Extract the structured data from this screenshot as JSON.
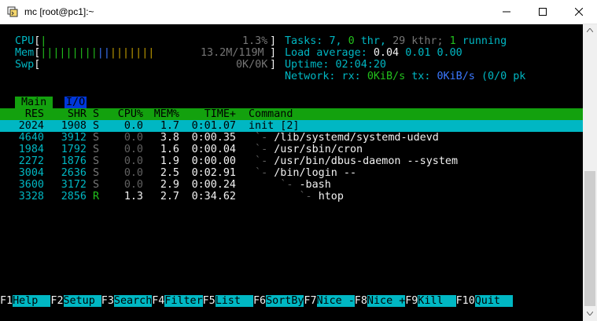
{
  "window": {
    "title": "mc [root@pc1]:~"
  },
  "meters": {
    "cpu": {
      "label": "CPU",
      "bar": "|",
      "value": "1.3%"
    },
    "mem": {
      "label": "Mem",
      "bar": "||||||||||||||||||",
      "value": "13.2M/119M"
    },
    "swp": {
      "label": "Swp",
      "value": "0K/0K"
    }
  },
  "summary": {
    "tasks_label": "Tasks:",
    "tasks": "7,",
    "thr": "0",
    "thr_label": "thr,",
    "kthr": "29",
    "kthr_label": "kthr;",
    "running": "1",
    "running_label": "running",
    "load_label": "Load average:",
    "load1": "0.04",
    "load5": "0.01",
    "load15": "0.00",
    "uptime_label": "Uptime:",
    "uptime": "02:04:20",
    "network_label": "Network: rx:",
    "rx": "0KiB/s",
    "tx_label": "tx:",
    "tx": "0KiB/s",
    "pkts": "(0/0 pk"
  },
  "tabs": {
    "main": "Main",
    "io": "I/O"
  },
  "columns": [
    "RES",
    "SHR",
    "S",
    "CPU%",
    "MEM%",
    "TIME+",
    "Command"
  ],
  "processes": [
    {
      "res": "2024",
      "shr": "1908",
      "s": "S",
      "cpu": "0.0",
      "mem": "1.7",
      "time": "0:01.07",
      "tree": "",
      "cmd": "init [2]"
    },
    {
      "res": "4640",
      "shr": "3912",
      "s": "S",
      "cpu": "0.0",
      "mem": "3.8",
      "time": "0:00.35",
      "tree": " `- ",
      "cmd": "/lib/systemd/systemd-udevd"
    },
    {
      "res": "1984",
      "shr": "1792",
      "s": "S",
      "cpu": "0.0",
      "mem": "1.6",
      "time": "0:00.04",
      "tree": " `- ",
      "cmd": "/usr/sbin/cron"
    },
    {
      "res": "2272",
      "shr": "1876",
      "s": "S",
      "cpu": "0.0",
      "mem": "1.9",
      "time": "0:00.00",
      "tree": " `- ",
      "cmd": "/usr/bin/dbus-daemon --system"
    },
    {
      "res": "3004",
      "shr": "2636",
      "s": "S",
      "cpu": "0.0",
      "mem": "2.5",
      "time": "0:02.91",
      "tree": " `- ",
      "cmd": "/bin/login --"
    },
    {
      "res": "3600",
      "shr": "3172",
      "s": "S",
      "cpu": "0.0",
      "mem": "2.9",
      "time": "0:00.24",
      "tree": "     `- ",
      "cmd": "-bash"
    },
    {
      "res": "3328",
      "shr": "2856",
      "s": "R",
      "cpu": "1.3",
      "mem": "2.7",
      "time": "0:34.62",
      "tree": "        `- ",
      "cmd": "htop"
    }
  ],
  "fkeys": [
    {
      "num": "F1",
      "label": "Help  "
    },
    {
      "num": "F2",
      "label": "Setup "
    },
    {
      "num": "F3",
      "label": "Search"
    },
    {
      "num": "F4",
      "label": "Filter"
    },
    {
      "num": "F5",
      "label": "List  "
    },
    {
      "num": "F6",
      "label": "SortBy"
    },
    {
      "num": "F7",
      "label": "Nice -"
    },
    {
      "num": "F8",
      "label": "Nice +"
    },
    {
      "num": "F9",
      "label": "Kill  "
    },
    {
      "num": "F10",
      "label": "Quit  "
    }
  ]
}
